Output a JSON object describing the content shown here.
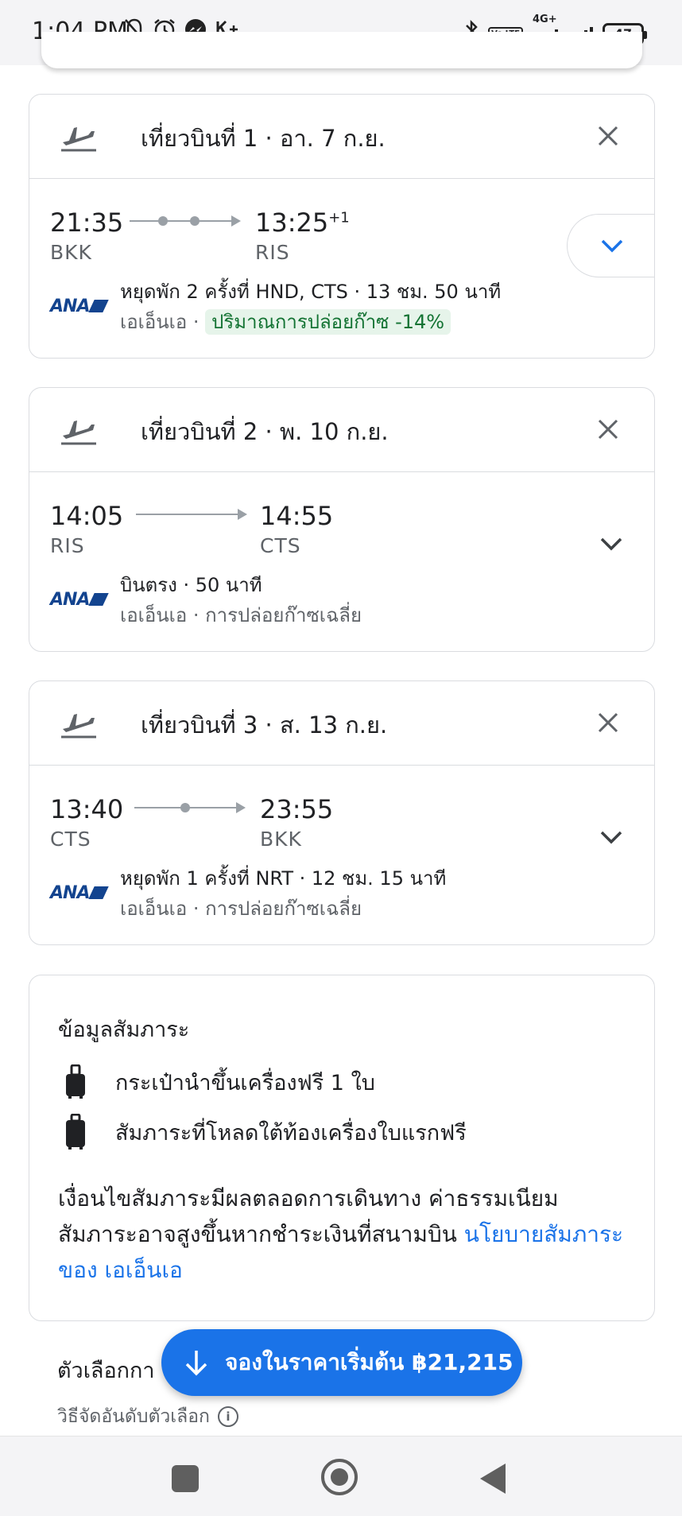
{
  "status_bar": {
    "time": "1:04 PM",
    "left_icons": [
      "mute-bell-icon",
      "alarm-icon",
      "messenger-icon",
      "k-plus-icon"
    ],
    "volte_label": "Vo LTE",
    "network_label": "4G+",
    "battery": "47"
  },
  "flights": [
    {
      "title": "เที่ยวบินที่ 1 · อา. 7 ก.ย.",
      "depart_time": "21:35",
      "depart_code": "BKK",
      "arrive_time": "13:25",
      "arrive_offset": "+1",
      "arrive_code": "RIS",
      "stops_text": "หยุดพัก 2 ครั้งที่ HND, CTS · 13 ชม. 50 นาที",
      "airline": "เอเอ็นเอ",
      "separator": " · ",
      "emission_text": "ปริมาณการปล่อยก๊าซ -14%",
      "logo_text": "ANA"
    },
    {
      "title": "เที่ยวบินที่ 2 · พ. 10 ก.ย.",
      "depart_time": "14:05",
      "depart_code": "RIS",
      "arrive_time": "14:55",
      "arrive_code": "CTS",
      "stops_text": "บินตรง · 50 นาที",
      "airline_line": "เอเอ็นเอ · การปล่อยก๊าซเฉลี่ย",
      "logo_text": "ANA"
    },
    {
      "title": "เที่ยวบินที่ 3 · ส. 13 ก.ย.",
      "depart_time": "13:40",
      "depart_code": "CTS",
      "arrive_time": "23:55",
      "arrive_code": "BKK",
      "stops_text": "หยุดพัก 1 ครั้งที่ NRT · 12 ชม. 15 นาที",
      "airline_line": "เอเอ็นเอ · การปล่อยก๊าซเฉลี่ย",
      "logo_text": "ANA"
    }
  ],
  "baggage": {
    "title": "ข้อมูลสัมภาระ",
    "items": [
      {
        "label": "กระเป๋านำขึ้นเครื่องฟรี 1 ใบ",
        "icon": "carry-on-bag-icon"
      },
      {
        "label": "สัมภาระที่โหลดใต้ท้องเครื่องใบแรกฟรี",
        "icon": "checked-bag-icon"
      }
    ],
    "note": "เงื่อนไขสัมภาระมีผลตลอดการเดินทาง ค่าธรรมเนียมสัมภาระอาจสูงขึ้นหากชำระเงินที่สนามบิน ",
    "link": "นโยบายสัมภาระของ เอเอ็นเอ"
  },
  "options": {
    "title": "ตัวเลือกกา",
    "sort_text": "วิธีจัดอันดับตัวเลือก",
    "info_glyph": "i"
  },
  "book_button": {
    "label": "จองในราคาเริ่มต้น ฿21,215"
  },
  "colors": {
    "accent": "#1a73e8",
    "emission_green": "#137333",
    "ana_blue": "#13448f"
  }
}
